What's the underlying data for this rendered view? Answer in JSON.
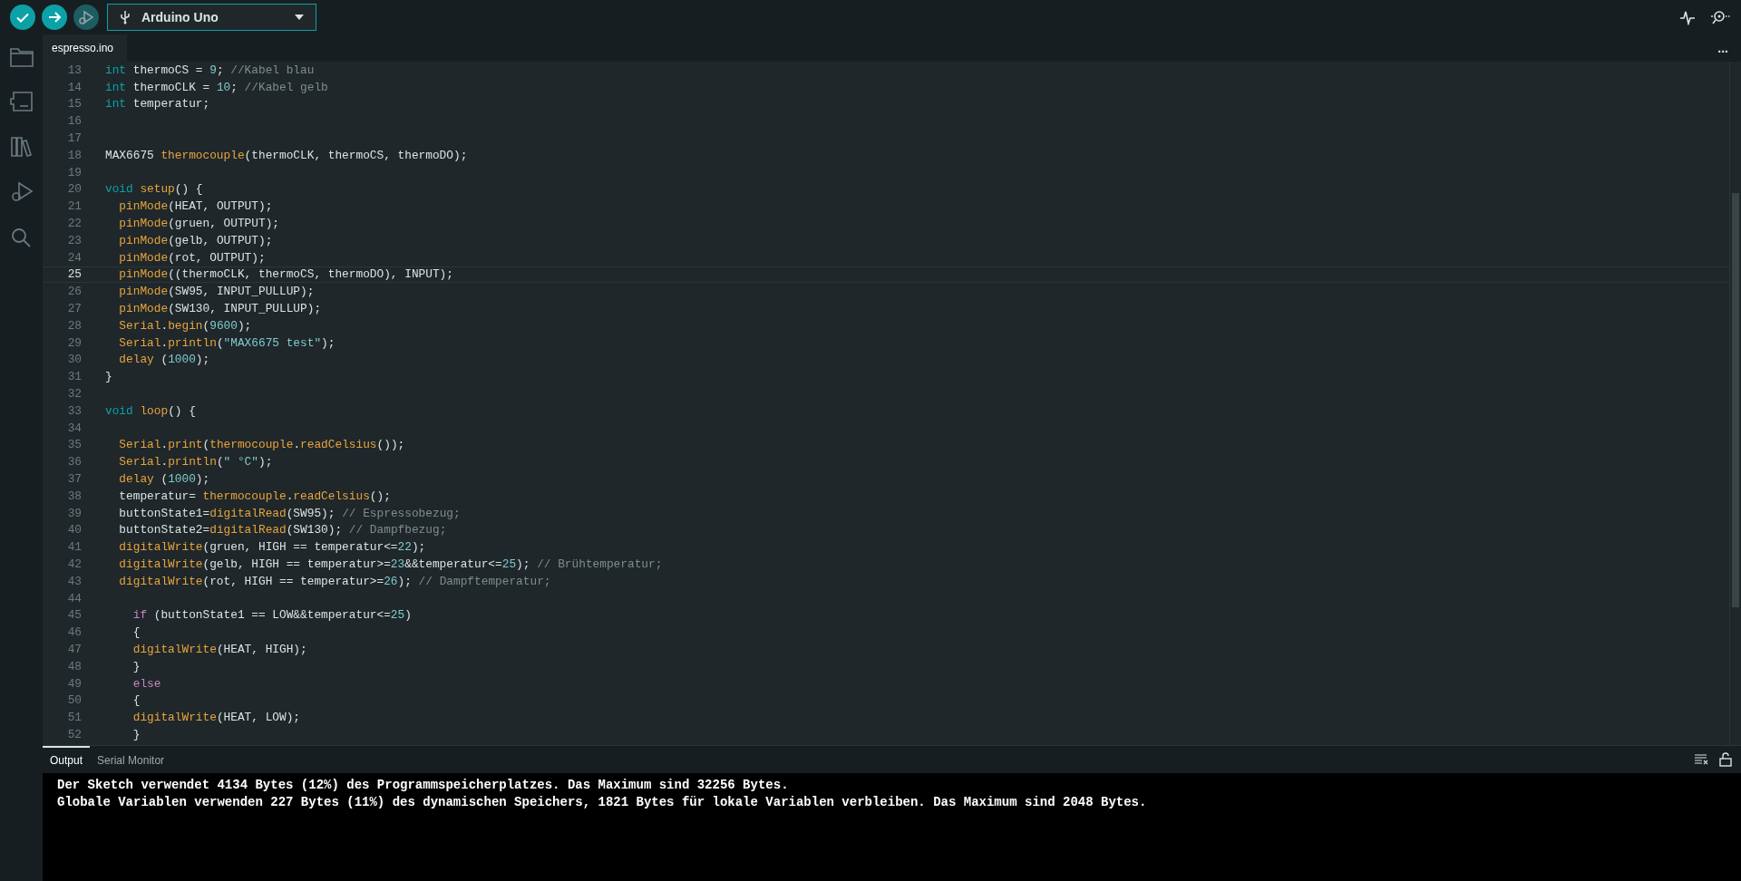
{
  "toolbar": {
    "buttons": [
      {
        "kind": "verify",
        "disabled": false
      },
      {
        "kind": "upload",
        "disabled": false
      },
      {
        "kind": "debug",
        "disabled": true
      }
    ],
    "board": "Arduino Uno",
    "right_buttons": [
      {
        "kind": "plotter"
      },
      {
        "kind": "monitor"
      }
    ]
  },
  "sidebar": {
    "items": [
      {
        "kind": "folder"
      },
      {
        "kind": "board"
      },
      {
        "kind": "library"
      },
      {
        "kind": "debug"
      },
      {
        "kind": "search"
      }
    ]
  },
  "tabs": [
    {
      "label": "espresso.ino",
      "selected": true
    }
  ],
  "more_menu": "...",
  "editor": {
    "lines": [
      {
        "number": "13",
        "current": false,
        "tokens": [
          {
            "kind": "keyword",
            "text": "int"
          },
          {
            "kind": "plain",
            "text": " thermoCS = "
          },
          {
            "kind": "number",
            "text": "9"
          },
          {
            "kind": "plain",
            "text": "; "
          },
          {
            "kind": "comment",
            "text": "//Kabel blau"
          }
        ]
      },
      {
        "number": "14",
        "current": false,
        "tokens": [
          {
            "kind": "keyword",
            "text": "int"
          },
          {
            "kind": "plain",
            "text": " thermoCLK = "
          },
          {
            "kind": "number",
            "text": "10"
          },
          {
            "kind": "plain",
            "text": "; "
          },
          {
            "kind": "comment",
            "text": "//Kabel gelb"
          }
        ]
      },
      {
        "number": "15",
        "current": false,
        "tokens": [
          {
            "kind": "keyword",
            "text": "int"
          },
          {
            "kind": "plain",
            "text": " temperatur;"
          }
        ]
      },
      {
        "number": "16",
        "current": false
      },
      {
        "number": "17",
        "current": false
      },
      {
        "number": "18",
        "current": false,
        "tokens": [
          {
            "kind": "plain",
            "text": "MAX6675 "
          },
          {
            "kind": "function",
            "text": "thermocouple"
          },
          {
            "kind": "plain",
            "text": "(thermoCLK, thermoCS, thermoDO);"
          }
        ]
      },
      {
        "number": "19",
        "current": false
      },
      {
        "number": "20",
        "current": false,
        "tokens": [
          {
            "kind": "keyword",
            "text": "void"
          },
          {
            "kind": "function",
            "text": " setup"
          },
          {
            "kind": "plain",
            "text": "() {"
          }
        ]
      },
      {
        "number": "21",
        "current": false,
        "tokens": [
          {
            "kind": "function",
            "text": "  pinMode"
          },
          {
            "kind": "plain",
            "text": "(HEAT, OUTPUT);"
          }
        ]
      },
      {
        "number": "22",
        "current": false,
        "tokens": [
          {
            "kind": "function",
            "text": "  pinMode"
          },
          {
            "kind": "plain",
            "text": "(gruen, OUTPUT);"
          }
        ]
      },
      {
        "number": "23",
        "current": false,
        "tokens": [
          {
            "kind": "function",
            "text": "  pinMode"
          },
          {
            "kind": "plain",
            "text": "(gelb, OUTPUT);"
          }
        ]
      },
      {
        "number": "24",
        "current": false,
        "tokens": [
          {
            "kind": "function",
            "text": "  pinMode"
          },
          {
            "kind": "plain",
            "text": "(rot, OUTPUT);"
          }
        ]
      },
      {
        "number": "25",
        "current": true,
        "tokens": [
          {
            "kind": "function",
            "text": "  pinMode"
          },
          {
            "kind": "plain",
            "text": "((thermoCLK, thermoCS, thermoDO), INPUT);"
          }
        ]
      },
      {
        "number": "26",
        "current": false,
        "tokens": [
          {
            "kind": "function",
            "text": "  pinMode"
          },
          {
            "kind": "plain",
            "text": "(SW95, INPUT_PULLUP);"
          }
        ]
      },
      {
        "number": "27",
        "current": false,
        "tokens": [
          {
            "kind": "function",
            "text": "  pinMode"
          },
          {
            "kind": "plain",
            "text": "(SW130, INPUT_PULLUP);"
          }
        ]
      },
      {
        "number": "28",
        "current": false,
        "tokens": [
          {
            "kind": "function",
            "text": "  Serial"
          },
          {
            "kind": "plain",
            "text": "."
          },
          {
            "kind": "function",
            "text": "begin"
          },
          {
            "kind": "plain",
            "text": "("
          },
          {
            "kind": "number",
            "text": "9600"
          },
          {
            "kind": "plain",
            "text": ");"
          }
        ]
      },
      {
        "number": "29",
        "current": false,
        "tokens": [
          {
            "kind": "function",
            "text": "  Serial"
          },
          {
            "kind": "plain",
            "text": "."
          },
          {
            "kind": "function",
            "text": "println"
          },
          {
            "kind": "plain",
            "text": "("
          },
          {
            "kind": "string",
            "text": "\"MAX6675 test\""
          },
          {
            "kind": "plain",
            "text": ");"
          }
        ]
      },
      {
        "number": "30",
        "current": false,
        "tokens": [
          {
            "kind": "function",
            "text": "  delay"
          },
          {
            "kind": "plain",
            "text": " ("
          },
          {
            "kind": "number",
            "text": "1000"
          },
          {
            "kind": "plain",
            "text": ");"
          }
        ]
      },
      {
        "number": "31",
        "current": false,
        "tokens": [
          {
            "kind": "plain",
            "text": "}"
          }
        ]
      },
      {
        "number": "32",
        "current": false
      },
      {
        "number": "33",
        "current": false,
        "tokens": [
          {
            "kind": "keyword",
            "text": "void"
          },
          {
            "kind": "function",
            "text": " loop"
          },
          {
            "kind": "plain",
            "text": "() {"
          }
        ]
      },
      {
        "number": "34",
        "current": false
      },
      {
        "number": "35",
        "current": false,
        "tokens": [
          {
            "kind": "function",
            "text": "  Serial"
          },
          {
            "kind": "plain",
            "text": "."
          },
          {
            "kind": "function",
            "text": "print"
          },
          {
            "kind": "plain",
            "text": "("
          },
          {
            "kind": "function",
            "text": "thermocouple"
          },
          {
            "kind": "plain",
            "text": "."
          },
          {
            "kind": "function",
            "text": "readCelsius"
          },
          {
            "kind": "plain",
            "text": "());"
          }
        ]
      },
      {
        "number": "36",
        "current": false,
        "tokens": [
          {
            "kind": "function",
            "text": "  Serial"
          },
          {
            "kind": "plain",
            "text": "."
          },
          {
            "kind": "function",
            "text": "println"
          },
          {
            "kind": "plain",
            "text": "("
          },
          {
            "kind": "string",
            "text": "\" °C\""
          },
          {
            "kind": "plain",
            "text": ");"
          }
        ]
      },
      {
        "number": "37",
        "current": false,
        "tokens": [
          {
            "kind": "function",
            "text": "  delay"
          },
          {
            "kind": "plain",
            "text": " ("
          },
          {
            "kind": "number",
            "text": "1000"
          },
          {
            "kind": "plain",
            "text": ");"
          }
        ]
      },
      {
        "number": "38",
        "current": false,
        "tokens": [
          {
            "kind": "plain",
            "text": "  temperatur= "
          },
          {
            "kind": "function",
            "text": "thermocouple"
          },
          {
            "kind": "plain",
            "text": "."
          },
          {
            "kind": "function",
            "text": "readCelsius"
          },
          {
            "kind": "plain",
            "text": "();"
          }
        ]
      },
      {
        "number": "39",
        "current": false,
        "tokens": [
          {
            "kind": "plain",
            "text": "  buttonState1="
          },
          {
            "kind": "function",
            "text": "digitalRead"
          },
          {
            "kind": "plain",
            "text": "(SW95); "
          },
          {
            "kind": "comment",
            "text": "// Espressobezug;"
          }
        ]
      },
      {
        "number": "40",
        "current": false,
        "tokens": [
          {
            "kind": "plain",
            "text": "  buttonState2="
          },
          {
            "kind": "function",
            "text": "digitalRead"
          },
          {
            "kind": "plain",
            "text": "(SW130); "
          },
          {
            "kind": "comment",
            "text": "// Dampfbezug;"
          }
        ]
      },
      {
        "number": "41",
        "current": false,
        "tokens": [
          {
            "kind": "function",
            "text": "  digitalWrite"
          },
          {
            "kind": "plain",
            "text": "(gruen, HIGH == temperatur<="
          },
          {
            "kind": "number",
            "text": "22"
          },
          {
            "kind": "plain",
            "text": ");"
          }
        ]
      },
      {
        "number": "42",
        "current": false,
        "tokens": [
          {
            "kind": "function",
            "text": "  digitalWrite"
          },
          {
            "kind": "plain",
            "text": "(gelb, HIGH == temperatur>="
          },
          {
            "kind": "number",
            "text": "23"
          },
          {
            "kind": "plain",
            "text": "&&temperatur<="
          },
          {
            "kind": "number",
            "text": "25"
          },
          {
            "kind": "plain",
            "text": "); "
          },
          {
            "kind": "comment",
            "text": "// Brühtemperatur;"
          }
        ]
      },
      {
        "number": "43",
        "current": false,
        "tokens": [
          {
            "kind": "function",
            "text": "  digitalWrite"
          },
          {
            "kind": "plain",
            "text": "(rot, HIGH == temperatur>="
          },
          {
            "kind": "number",
            "text": "26"
          },
          {
            "kind": "plain",
            "text": "); "
          },
          {
            "kind": "comment",
            "text": "// Dampftemperatur;"
          }
        ]
      },
      {
        "number": "44",
        "current": false
      },
      {
        "number": "45",
        "current": false,
        "tokens": [
          {
            "kind": "control",
            "text": "    if"
          },
          {
            "kind": "plain",
            "text": " (buttonState1 == LOW&&temperatur<="
          },
          {
            "kind": "number",
            "text": "25"
          },
          {
            "kind": "plain",
            "text": ")"
          }
        ]
      },
      {
        "number": "46",
        "current": false,
        "tokens": [
          {
            "kind": "plain",
            "text": "    {"
          }
        ]
      },
      {
        "number": "47",
        "current": false,
        "tokens": [
          {
            "kind": "function",
            "text": "    digitalWrite"
          },
          {
            "kind": "plain",
            "text": "(HEAT, HIGH);"
          }
        ]
      },
      {
        "number": "48",
        "current": false,
        "tokens": [
          {
            "kind": "plain",
            "text": "    }"
          }
        ]
      },
      {
        "number": "49",
        "current": false,
        "tokens": [
          {
            "kind": "control",
            "text": "    else"
          }
        ]
      },
      {
        "number": "50",
        "current": false,
        "tokens": [
          {
            "kind": "plain",
            "text": "    {"
          }
        ]
      },
      {
        "number": "51",
        "current": false,
        "tokens": [
          {
            "kind": "function",
            "text": "    digitalWrite"
          },
          {
            "kind": "plain",
            "text": "(HEAT, LOW);"
          }
        ]
      },
      {
        "number": "52",
        "current": false,
        "tokens": [
          {
            "kind": "plain",
            "text": "    }"
          }
        ]
      }
    ]
  },
  "output": {
    "tabs": [
      {
        "label": "Output",
        "selected": true
      },
      {
        "label": "Serial Monitor",
        "selected": false
      }
    ],
    "lines": [
      "Der Sketch verwendet 4134 Bytes (12%) des Programmspeicherplatzes. Das Maximum sind 32256 Bytes.",
      "Globale Variablen verwenden 227 Bytes (11%) des dynamischen Speichers, 1821 Bytes für lokale Variablen verbleiben. Das Maximum sind 2048 Bytes."
    ]
  }
}
